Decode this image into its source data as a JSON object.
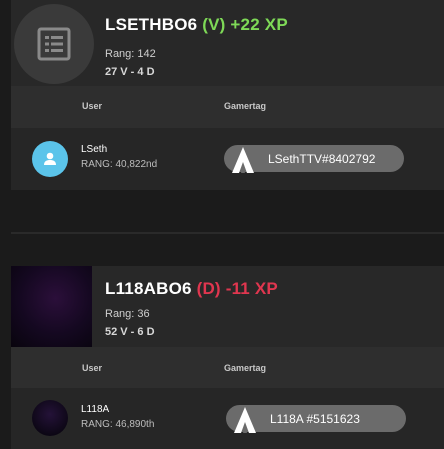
{
  "matches": [
    {
      "title": "LSETHBO6",
      "result": "(V)",
      "xp": "+22 XP",
      "result_color": "#7ed957",
      "rank": "Rang: 142",
      "record": "27 V - 4 D",
      "columns": {
        "user": "User",
        "gamertag": "Gamertag"
      },
      "player": {
        "name": "LSeth",
        "rank": "RANG: 40,822nd",
        "gamertag": "LSethTTV#8402792",
        "avatar_icon": "person-icon"
      },
      "avatar_icon": "list-icon"
    },
    {
      "title": "L118ABO6",
      "result": "(D)",
      "xp": "-11 XP",
      "result_color": "#e0364f",
      "rank": "Rang: 36",
      "record": "52 V - 6 D",
      "columns": {
        "user": "User",
        "gamertag": "Gamertag"
      },
      "player": {
        "name": "L118A",
        "rank": "RANG: 46,890th",
        "gamertag": "L118A #5151623"
      }
    }
  ]
}
